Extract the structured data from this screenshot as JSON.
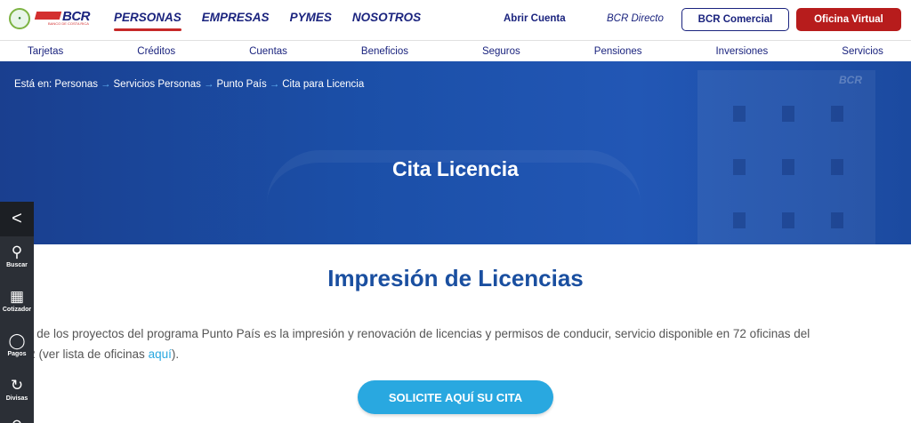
{
  "brand": {
    "logo_text": "BCR",
    "logo_sub": "BANCO DE COSTA RICA"
  },
  "main_nav": [
    "PERSONAS",
    "EMPRESAS",
    "PYMES",
    "NOSOTROS"
  ],
  "top_links": {
    "abrir": "Abrir Cuenta",
    "directo": "BCR Directo"
  },
  "buttons": {
    "comercial": "BCR Comercial",
    "virtual": "Oficina Virtual",
    "cta": "SOLICITE AQUÍ SU CITA"
  },
  "sub_nav": [
    "Tarjetas",
    "Créditos",
    "Cuentas",
    "Beneficios",
    "Seguros",
    "Pensiones",
    "Inversiones",
    "Servicios"
  ],
  "breadcrumb": {
    "prefix": "Está en:",
    "items": [
      "Personas",
      "Servicios Personas",
      "Punto País",
      "Cita para Licencia"
    ]
  },
  "hero": {
    "title": "Cita Licencia",
    "sign": "BCR"
  },
  "section": {
    "title": "Impresión de Licencias",
    "para_text": "o de los proyectos del programa Punto País es la impresión y renovación de licencias y permisos de conducir, servicio disponible en 72 oficinas del",
    "para_line2_pre": "R (ver lista de oficinas ",
    "para_link": "aquí",
    "para_line2_post": ")."
  },
  "sidebar": {
    "toggle": "<",
    "items": [
      {
        "label": "Buscar",
        "icon": "search-icon"
      },
      {
        "label": "Cotizador",
        "icon": "calculator-icon"
      },
      {
        "label": "Pagos",
        "icon": "bulb-icon"
      },
      {
        "label": "Divisas",
        "icon": "currency-icon"
      }
    ]
  },
  "colors": {
    "navy": "#1a237e",
    "red": "#b71c1c",
    "cyan": "#29a8e0",
    "hero": "#1b4fa8"
  }
}
